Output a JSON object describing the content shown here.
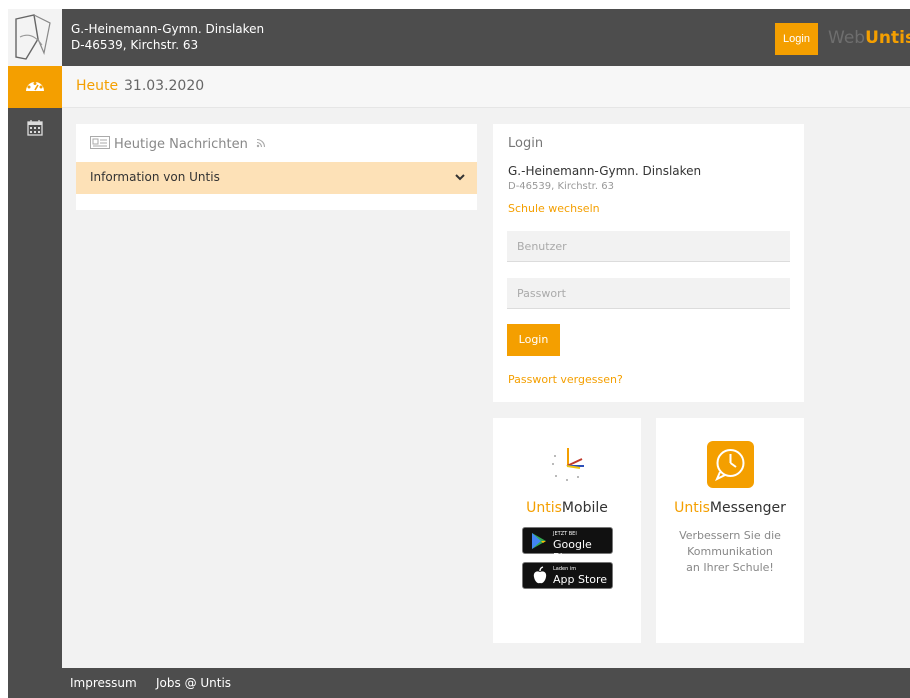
{
  "header": {
    "school_name": "G.-Heinemann-Gymn. Dinslaken",
    "school_address": "D-46539, Kirchstr. 63",
    "login_label": "Login",
    "brand_part1": "Web",
    "brand_part2": "Untis"
  },
  "sidebar": {
    "items": [
      {
        "name": "dashboard",
        "icon": "palette-icon",
        "active": true
      },
      {
        "name": "timetable",
        "icon": "calendar-icon",
        "active": false
      }
    ]
  },
  "datebar": {
    "heute": "Heute",
    "date": "31.03.2020"
  },
  "news": {
    "title": "Heutige Nachrichten",
    "item_label": "Information von Untis"
  },
  "login": {
    "title": "Login",
    "school_name": "G.-Heinemann-Gymn. Dinslaken",
    "school_address": "D-46539, Kirchstr. 63",
    "change_school": "Schule wechseln",
    "user_placeholder": "Benutzer",
    "password_placeholder": "Passwort",
    "button": "Login",
    "forgot": "Passwort vergessen?"
  },
  "mobile": {
    "title_part1": "Untis",
    "title_part2": "Mobile",
    "google_small": "JETZT BEI",
    "google_big": "Google Play",
    "apple_small": "Laden im",
    "apple_big": "App Store"
  },
  "messenger": {
    "title_part1": "Untis",
    "title_part2": "Messenger",
    "line1": "Verbessern Sie die",
    "line2": "Kommunikation",
    "line3": "an Ihrer Schule!"
  },
  "footer": {
    "impressum": "Impressum",
    "jobs": "Jobs @ Untis"
  },
  "colors": {
    "accent": "#f49f00",
    "dark": "#4d4d4d"
  }
}
